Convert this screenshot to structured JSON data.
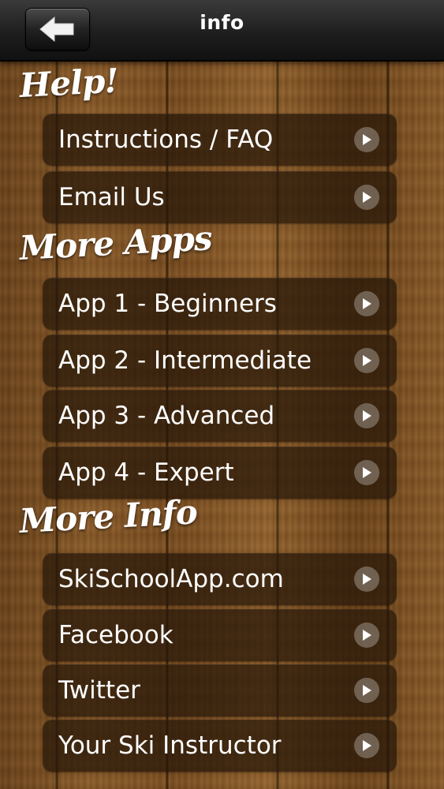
{
  "header": {
    "title": "info",
    "back_icon": "back-arrow-icon"
  },
  "sections": {
    "help": {
      "heading": "Help!",
      "items": [
        {
          "label": "Instructions / FAQ"
        },
        {
          "label": "Email Us"
        }
      ]
    },
    "more_apps": {
      "heading": "More Apps",
      "items": [
        {
          "label": "App 1 - Beginners"
        },
        {
          "label": "App 2 - Intermediate"
        },
        {
          "label": "App 3 - Advanced"
        },
        {
          "label": "App 4 - Expert"
        }
      ]
    },
    "more_info": {
      "heading": "More Info",
      "items": [
        {
          "label": "SkiSchoolApp.com"
        },
        {
          "label": "Facebook"
        },
        {
          "label": "Twitter"
        },
        {
          "label": "Your Ski Instructor"
        }
      ]
    }
  },
  "colors": {
    "wood": "#7a4e22",
    "topbar": "#1e1e1e",
    "row_bg": "#261608",
    "text": "#ffffff"
  },
  "row_icon": "chevron-right-icon"
}
